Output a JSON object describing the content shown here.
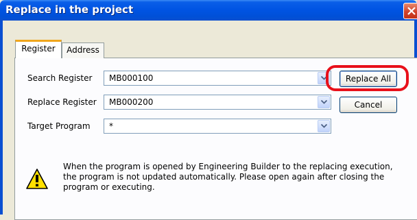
{
  "window": {
    "title": "Replace in the project"
  },
  "tabs": [
    {
      "label": "Register",
      "active": true
    },
    {
      "label": "Address",
      "active": false
    }
  ],
  "form": {
    "search_register": {
      "label": "Search Register",
      "value": "MB000100"
    },
    "replace_register": {
      "label": "Replace Register",
      "value": "MB000200"
    },
    "target_program": {
      "label": "Target Program",
      "value": "*"
    }
  },
  "buttons": {
    "replace_all": "Replace All",
    "cancel": "Cancel"
  },
  "warning": {
    "icon": "warning-icon",
    "lines": [
      "When the program is opened by Engineering Builder to the replacing execution,",
      "the program is not updated automatically. Please open again after closing the",
      "program or executing."
    ]
  },
  "colors": {
    "titlebar": "#0054e3",
    "highlight": "#e8101a",
    "tab_accent": "#f0a61c"
  }
}
